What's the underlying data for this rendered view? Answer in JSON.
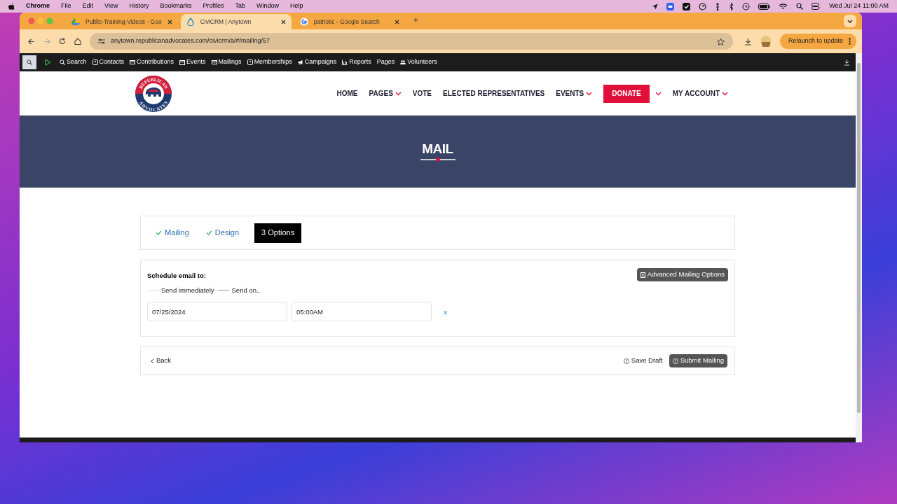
{
  "menu_bar": {
    "app": "Chrome",
    "items": [
      "File",
      "Edit",
      "View",
      "History",
      "Bookmarks",
      "Profiles",
      "Tab",
      "Window",
      "Help"
    ],
    "clock": "Wed Jul 24  11:00 AM"
  },
  "browser": {
    "tabs": [
      {
        "title": "Public-Training-Videos - Goo",
        "selected": false,
        "kind": "drive"
      },
      {
        "title": "CiviCRM | Anytown",
        "selected": true,
        "kind": "drop"
      },
      {
        "title": "patriotic - Google Search",
        "selected": false,
        "kind": "google"
      }
    ],
    "new_tab": "+",
    "url": "anytown.republicanadvocates.com/civicrm/a/#/mailing/57",
    "relaunch": "Relaunch to update"
  },
  "civicrm_menu": [
    {
      "label": "Search",
      "kind": "search"
    },
    {
      "label": "Contacts",
      "kind": "card"
    },
    {
      "label": "Contributions",
      "kind": "money"
    },
    {
      "label": "Events",
      "kind": "calendar"
    },
    {
      "label": "Mailings",
      "kind": "mail"
    },
    {
      "label": "Memberships",
      "kind": "card"
    },
    {
      "label": "Campaigns",
      "kind": "megaphone"
    },
    {
      "label": "Reports",
      "kind": "chart"
    },
    {
      "label": "Pages",
      "kind": "plain"
    },
    {
      "label": "Volunteers",
      "kind": "people"
    }
  ],
  "site": {
    "logo": {
      "top": "REPUBLICAN",
      "bottom": "ADVOCATES"
    },
    "nav": [
      {
        "label": "HOME",
        "dropdown": false,
        "kind": "link"
      },
      {
        "label": "PAGES",
        "dropdown": true,
        "kind": "link"
      },
      {
        "label": "VOTE",
        "dropdown": false,
        "kind": "link"
      },
      {
        "label": "ELECTED REPRESENTATIVES",
        "dropdown": false,
        "kind": "link"
      },
      {
        "label": "EVENTS",
        "dropdown": true,
        "kind": "link"
      },
      {
        "label": "DONATE",
        "dropdown": true,
        "kind": "button"
      },
      {
        "label": "MY ACCOUNT",
        "dropdown": true,
        "kind": "link"
      }
    ]
  },
  "hero": {
    "title": "MAIL"
  },
  "wizard": {
    "steps": [
      {
        "label": "Mailing",
        "done": true,
        "selected": false
      },
      {
        "label": "Design",
        "done": true,
        "selected": false
      },
      {
        "label": "3 Options",
        "done": false,
        "selected": true
      }
    ]
  },
  "schedule": {
    "label": "Schedule email to:",
    "advanced_button": "Advanced Mailing Options",
    "options": [
      {
        "label": "Send immediately",
        "selected": false
      },
      {
        "label": "Send on..",
        "selected": true
      }
    ],
    "date": "07/25/2024",
    "time": "05:00AM",
    "clear": "×"
  },
  "footer": {
    "back": "Back",
    "save_draft": "Save Draft",
    "submit": "Submit Mailing"
  }
}
